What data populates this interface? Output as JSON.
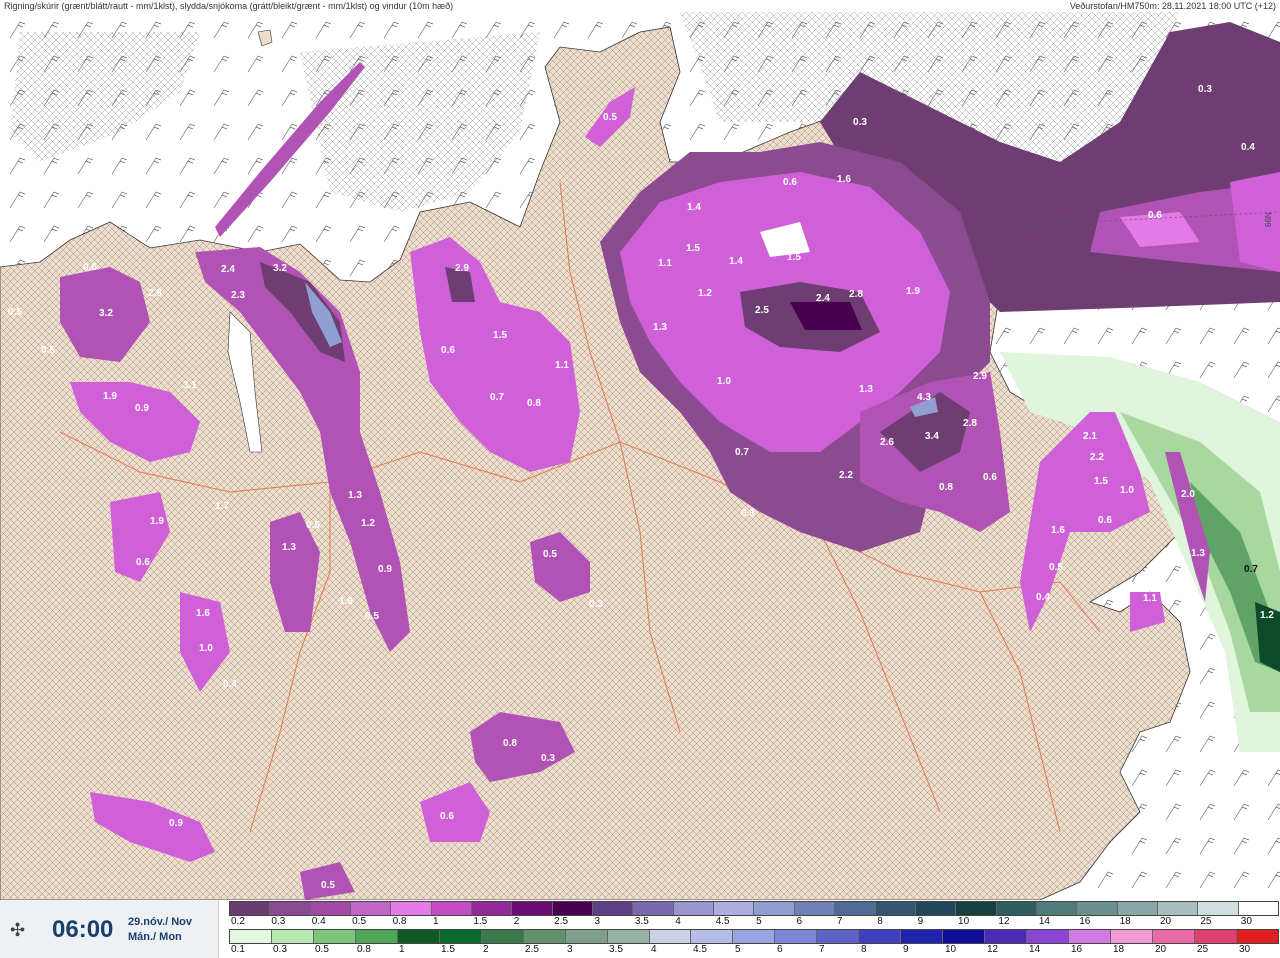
{
  "header": {
    "left": "Rigning/skúrir (grænt/blátt/rautt - mm/1klst), slydda/snjókoma (grátt/bleikt/grænt - mm/1klst) og vindur (10m hæð)",
    "right": "Veðurstofan/HM750m: 28.11.2021 18:00 UTC (+12)"
  },
  "edge_label": "66N",
  "time": {
    "hour": "06:00",
    "date_line1": "29.nóv./ Nov",
    "date_line2": "Mán./ Mon"
  },
  "colors": {
    "land": "#f0dccb",
    "sea": "#ffffff",
    "road": "#e07a50",
    "snow": [
      "#6e3d72",
      "#8c4a90",
      "#b053b4",
      "#d060d8",
      "#e47ae8",
      "#f0a0f0"
    ],
    "rain": [
      "#dff5dc",
      "#a8d8a0",
      "#5fa466",
      "#1f6a3c",
      "#0c4a2a"
    ]
  },
  "scale_top": {
    "labels": [
      "0.2",
      "0.3",
      "0.4",
      "0.5",
      "0.8",
      "1",
      "1.5",
      "2",
      "2.5",
      "3",
      "3.5",
      "4",
      "4.5",
      "5",
      "6",
      "7",
      "8",
      "9",
      "10",
      "12",
      "14",
      "16",
      "18",
      "20",
      "25",
      "30"
    ],
    "colors": [
      "#6a3b6e",
      "#8b4a8f",
      "#a04aa6",
      "#c066c6",
      "#e57ae9",
      "#c44cc8",
      "#932a99",
      "#6b0a70",
      "#4a0050",
      "#5d3f86",
      "#7b69ae",
      "#9a95d0",
      "#adadde",
      "#8f9fd2",
      "#6f82b8",
      "#4f6a96",
      "#35566f",
      "#21485a",
      "#164040",
      "#2e5d5d",
      "#4f7b7b",
      "#6c9090",
      "#89a7a7",
      "#a9bebe",
      "#cfdede",
      "#ffffff"
    ]
  },
  "scale_bottom": {
    "labels": [
      "0.1",
      "0.3",
      "0.5",
      "0.8",
      "1",
      "1.5",
      "2",
      "2.5",
      "3",
      "3.5",
      "4",
      "4.5",
      "5",
      "6",
      "7",
      "8",
      "9",
      "10",
      "12",
      "14",
      "16",
      "18",
      "20",
      "25",
      "30"
    ],
    "colors": [
      "#e2f8df",
      "#b7e6b0",
      "#7fc47c",
      "#4fa558",
      "#0f5a24",
      "#0a6a2d",
      "#3a7a4a",
      "#62906a",
      "#7d9f8a",
      "#96b2a2",
      "#c9d1e2",
      "#b5bde6",
      "#9ba4e2",
      "#7d85d7",
      "#5e63c8",
      "#4040bf",
      "#2222b0",
      "#0e0e96",
      "#4a2bb8",
      "#8a45d3",
      "#d07be3",
      "#f19ad6",
      "#e86aa6",
      "#e04070",
      "#e01e20"
    ]
  },
  "precip_labels": [
    {
      "v": "0.5"
    },
    {
      "v": "0.3"
    },
    {
      "v": "0.4"
    },
    {
      "v": "0.3"
    },
    {
      "v": "0.6"
    },
    {
      "v": "0.4"
    },
    {
      "v": "0.6"
    },
    {
      "v": "1.4"
    },
    {
      "v": "1.6"
    },
    {
      "v": "0.6"
    },
    {
      "v": "2.4"
    },
    {
      "v": "3.2"
    },
    {
      "v": "2.3"
    },
    {
      "v": "2.8"
    },
    {
      "v": "3.2"
    },
    {
      "v": "0.5"
    },
    {
      "v": "2.9"
    },
    {
      "v": "1.5"
    },
    {
      "v": "1.1"
    },
    {
      "v": "1.5"
    },
    {
      "v": "1.4"
    },
    {
      "v": "1.5"
    },
    {
      "v": "1.2"
    },
    {
      "v": "1.3"
    },
    {
      "v": "2.5"
    },
    {
      "v": "2.4"
    },
    {
      "v": "2.8"
    },
    {
      "v": "1.9"
    },
    {
      "v": "1.0"
    },
    {
      "v": "1.3"
    },
    {
      "v": "3.1"
    },
    {
      "v": "1.9"
    },
    {
      "v": "0.9"
    },
    {
      "v": "0.5"
    },
    {
      "v": "0.6"
    },
    {
      "v": "0.7"
    },
    {
      "v": "1.1"
    },
    {
      "v": "0.8"
    },
    {
      "v": "4.3"
    },
    {
      "v": "2.9"
    },
    {
      "v": "2.6"
    },
    {
      "v": "3.4"
    },
    {
      "v": "2.8"
    },
    {
      "v": "2.2"
    },
    {
      "v": "0.8"
    },
    {
      "v": "0.6"
    },
    {
      "v": "0.7"
    },
    {
      "v": "0.3"
    },
    {
      "v": "1.3"
    },
    {
      "v": "1.2"
    },
    {
      "v": "1.3"
    },
    {
      "v": "0.5"
    },
    {
      "v": "0.9"
    },
    {
      "v": "1.6"
    },
    {
      "v": "0.5"
    },
    {
      "v": "1.9"
    },
    {
      "v": "0.6"
    },
    {
      "v": "1.7"
    },
    {
      "v": "1.6"
    },
    {
      "v": "1.0"
    },
    {
      "v": "0.4"
    },
    {
      "v": "0.5"
    },
    {
      "v": "0.3"
    },
    {
      "v": "0.8"
    },
    {
      "v": "0.3"
    },
    {
      "v": "0.6"
    },
    {
      "v": "0.9"
    },
    {
      "v": "0.5"
    },
    {
      "v": "2.1"
    },
    {
      "v": "2.2"
    },
    {
      "v": "1.5"
    },
    {
      "v": "1.0"
    },
    {
      "v": "1.6"
    },
    {
      "v": "0.6"
    },
    {
      "v": "0.5"
    },
    {
      "v": "0.4"
    },
    {
      "v": "2.0"
    },
    {
      "v": "1.3"
    },
    {
      "v": "0.7"
    },
    {
      "v": "1.2"
    },
    {
      "v": "1.1"
    }
  ]
}
